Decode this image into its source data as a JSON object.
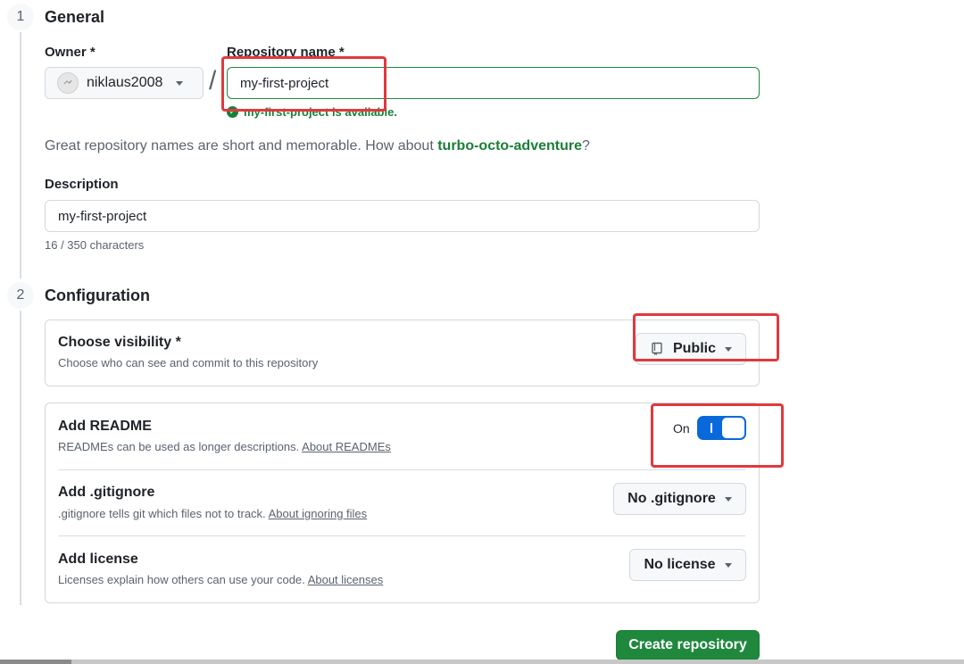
{
  "general": {
    "step": "1",
    "title": "General",
    "owner_label": "Owner *",
    "owner_value": "niklaus2008",
    "separator": "/",
    "repo_label": "Repository name *",
    "repo_value": "my-first-project",
    "availability": "my-first-project is available.",
    "suggestion_prefix": "Great repository names are short and memorable. How about ",
    "suggestion_name": "turbo-octo-adventure",
    "suggestion_suffix": "?",
    "description_label": "Description",
    "description_value": "my-first-project",
    "char_count": "16 / 350 characters"
  },
  "configuration": {
    "step": "2",
    "title": "Configuration",
    "visibility": {
      "title": "Choose visibility *",
      "desc": "Choose who can see and commit to this repository",
      "value": "Public"
    },
    "readme": {
      "title": "Add README",
      "desc": "READMEs can be used as longer descriptions.",
      "link": "About READMEs",
      "toggle_label": "On",
      "toggle_on": true
    },
    "gitignore": {
      "title": "Add .gitignore",
      "desc": ".gitignore tells git which files not to track.",
      "link": "About ignoring files",
      "value": "No .gitignore"
    },
    "license": {
      "title": "Add license",
      "desc": "Licenses explain how others can use your code.",
      "link": "About licenses",
      "value": "No license"
    }
  },
  "create_button": "Create repository",
  "colors": {
    "accent_green": "#1f883d",
    "toggle_blue": "#0969da",
    "annotation_red": "#e0393e"
  }
}
